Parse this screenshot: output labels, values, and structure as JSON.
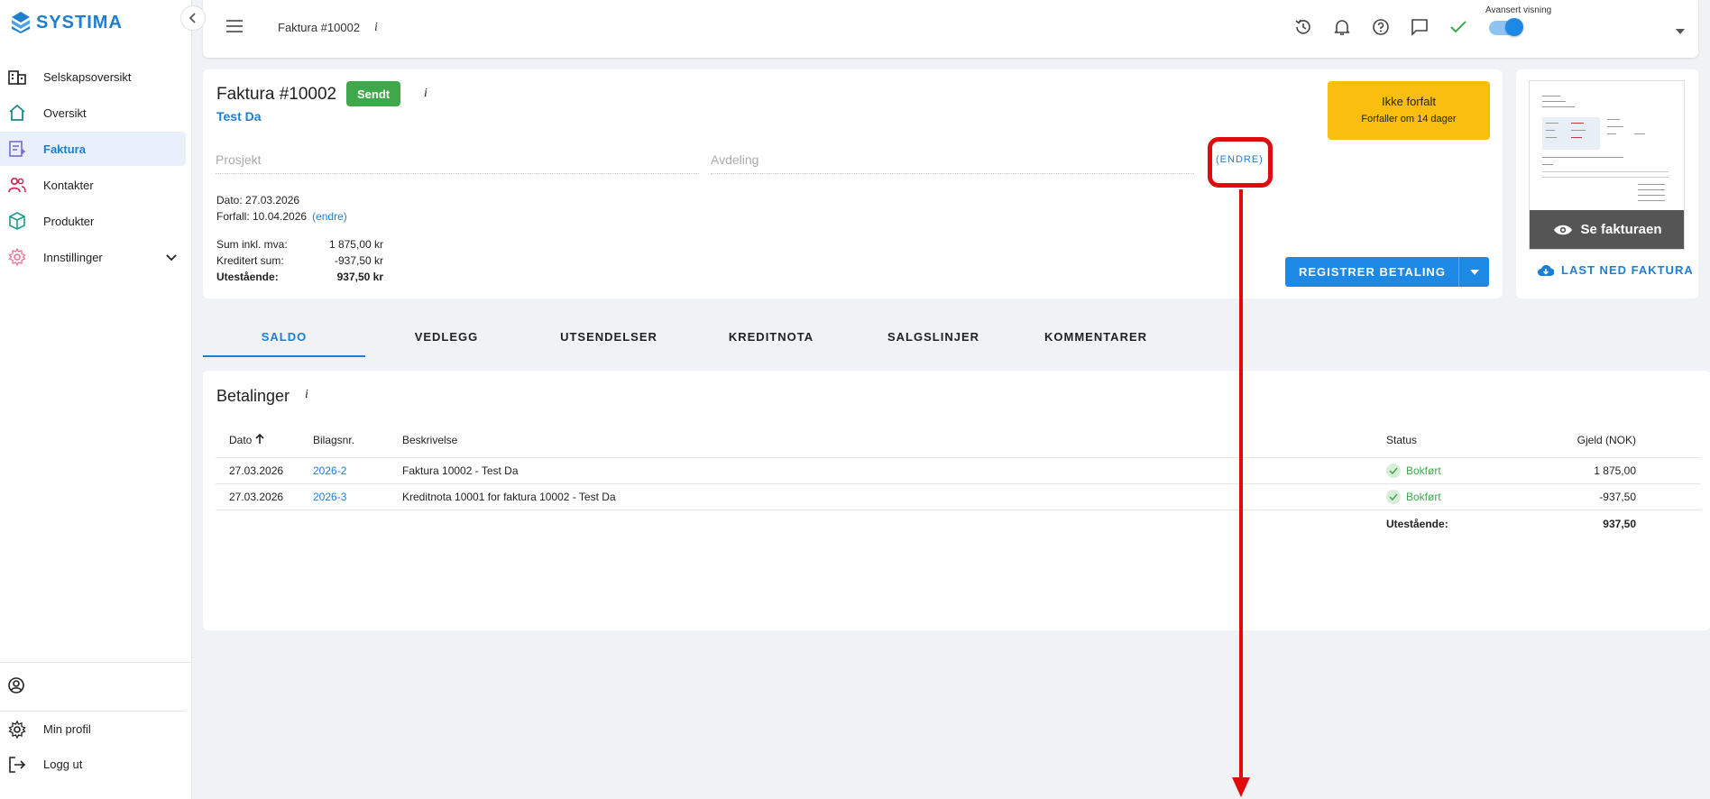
{
  "brand": {
    "name": "SYSTIMA",
    "color": "#1f7ed0"
  },
  "sidebar": {
    "items": [
      {
        "label": "Selskapsoversikt",
        "icon": "building-icon"
      },
      {
        "label": "Oversikt",
        "icon": "home-icon"
      },
      {
        "label": "Faktura",
        "icon": "invoice-icon",
        "active": true
      },
      {
        "label": "Kontakter",
        "icon": "contacts-icon"
      },
      {
        "label": "Produkter",
        "icon": "box-icon"
      },
      {
        "label": "Innstillinger",
        "icon": "gear-icon"
      }
    ],
    "bottom": {
      "profile": "Min profil",
      "logout": "Logg ut"
    }
  },
  "topbar": {
    "title": "Faktura #10002",
    "info": "i",
    "advanced_label": "Avansert visning",
    "advanced_on": true
  },
  "invoice": {
    "title": "Faktura #10002",
    "status_badge": "Sendt",
    "info": "i",
    "customer": "Test Da",
    "prosjekt_placeholder": "Prosjekt",
    "avdeling_placeholder": "Avdeling",
    "endre_label": "(ENDRE)",
    "dato_line": "Dato: 27.03.2026",
    "forfall_line": "Forfall: 10.04.2026",
    "forfall_endre": "(endre)",
    "sums": [
      {
        "label": "Sum inkl. mva:",
        "value": "1 875,00 kr"
      },
      {
        "label": "Kreditert sum:",
        "value": "-937,50 kr"
      },
      {
        "label": "Utestående:",
        "value": "937,50 kr"
      }
    ],
    "due_status": "Ikke forfalt",
    "due_sub": "Forfaller om 14 dager",
    "due_color": "#f9be0f",
    "register_payment": "REGISTRER BETALING"
  },
  "preview": {
    "view_label": "Se fakturaen",
    "download_label": "LAST NED FAKTURA"
  },
  "tabs": [
    "SALDO",
    "VEDLEGG",
    "UTSENDELSER",
    "KREDITNOTA",
    "SALGSLINJER",
    "KOMMENTARER"
  ],
  "payments": {
    "title": "Betalinger",
    "info": "i",
    "headers": {
      "dato": "Dato",
      "bilag": "Bilagsnr.",
      "beskrivelse": "Beskrivelse",
      "status": "Status",
      "gjeld": "Gjeld (NOK)"
    },
    "rows": [
      {
        "dato": "27.03.2026",
        "bilag": "2026-2",
        "beskrivelse": "Faktura 10002 - Test Da",
        "status": "Bokført",
        "gjeld": "1 875,00"
      },
      {
        "dato": "27.03.2026",
        "bilag": "2026-3",
        "beskrivelse": "Kreditnota 10001 for faktura 10002 - Test Da",
        "status": "Bokført",
        "gjeld": "-937,50"
      }
    ],
    "total_label": "Utestående:",
    "total_value": "937,50"
  }
}
